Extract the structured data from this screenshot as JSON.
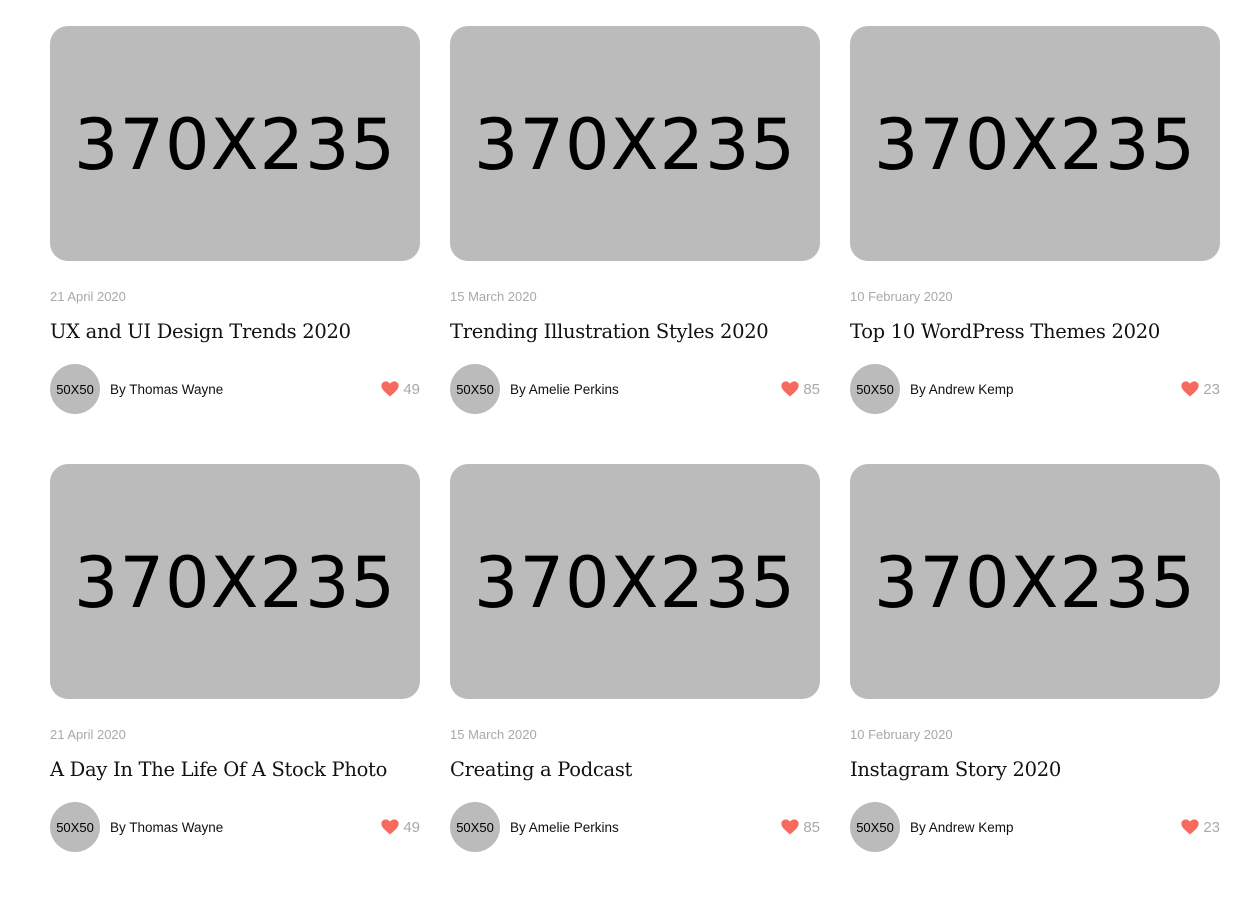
{
  "colors": {
    "placeholder_bg": "#bbbbbb",
    "heart": "#f76a60",
    "muted_text": "#a9a9a9",
    "text": "#111111"
  },
  "posts": [
    {
      "image_label": "370X235",
      "date": "21 April 2020",
      "title": "UX and UI Design Trends 2020",
      "avatar_label": "50X50",
      "author": "By Thomas Wayne",
      "likes": "49",
      "like_icon": "heart-icon"
    },
    {
      "image_label": "370X235",
      "date": "15 March 2020",
      "title": "Trending Illustration Styles 2020",
      "avatar_label": "50X50",
      "author": "By Amelie Perkins",
      "likes": "85",
      "like_icon": "heart-icon"
    },
    {
      "image_label": "370X235",
      "date": "10 February 2020",
      "title": "Top 10 WordPress Themes 2020",
      "avatar_label": "50X50",
      "author": "By Andrew Kemp",
      "likes": "23",
      "like_icon": "heart-icon"
    },
    {
      "image_label": "370X235",
      "date": "21 April 2020",
      "title": "A Day In The Life Of A Stock Photo",
      "avatar_label": "50X50",
      "author": "By Thomas Wayne",
      "likes": "49",
      "like_icon": "heart-icon"
    },
    {
      "image_label": "370X235",
      "date": "15 March 2020",
      "title": "Creating a Podcast",
      "avatar_label": "50X50",
      "author": "By Amelie Perkins",
      "likes": "85",
      "like_icon": "heart-icon"
    },
    {
      "image_label": "370X235",
      "date": "10 February 2020",
      "title": "Instagram Story 2020",
      "avatar_label": "50X50",
      "author": "By Andrew Kemp",
      "likes": "23",
      "like_icon": "heart-icon"
    }
  ]
}
